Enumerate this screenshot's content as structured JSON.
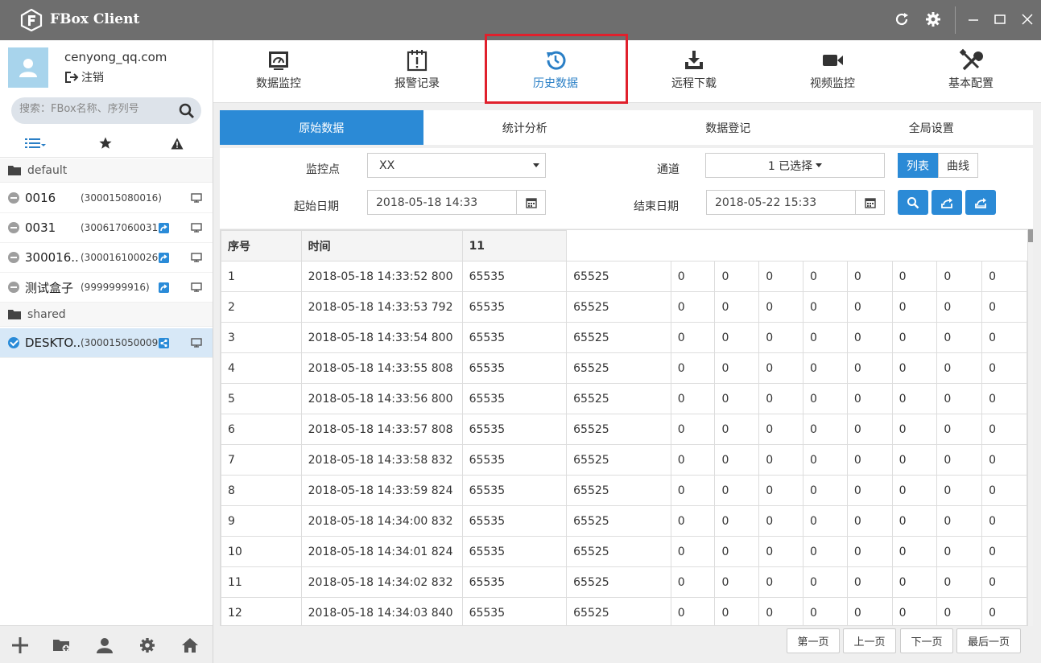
{
  "app": {
    "title": "FBox Client"
  },
  "sidebar": {
    "user_email": "cenyong_qq.com",
    "logout_label": "注销",
    "search_placeholder": "搜索：FBox名称、序列号",
    "groups": [
      {
        "label": "default"
      },
      {
        "label": "shared"
      }
    ],
    "devices": [
      {
        "name": "0016",
        "serial": "(300015080016)",
        "status": "offline",
        "badge": false
      },
      {
        "name": "0031",
        "serial": "(300617060031)",
        "status": "offline",
        "badge": true
      },
      {
        "name": "300016..",
        "serial": "(300016100026)",
        "status": "offline",
        "badge": true
      },
      {
        "name": "测试盒子",
        "serial": "(9999999916)",
        "status": "offline",
        "badge": true
      },
      {
        "name": "DESKTO..",
        "serial": "(300015050009)",
        "status": "online",
        "badge": true
      }
    ]
  },
  "nav": {
    "items": [
      {
        "label": "数据监控",
        "icon": "dashboard-icon"
      },
      {
        "label": "报警记录",
        "icon": "alarm-icon"
      },
      {
        "label": "历史数据",
        "icon": "history-icon"
      },
      {
        "label": "远程下载",
        "icon": "download-icon"
      },
      {
        "label": "视频监控",
        "icon": "video-icon"
      },
      {
        "label": "基本配置",
        "icon": "tools-icon"
      }
    ],
    "active": "历史数据"
  },
  "subtabs": [
    "原始数据",
    "统计分析",
    "数据登记",
    "全局设置"
  ],
  "filters": {
    "monitor_label": "监控点",
    "monitor_value": "XX",
    "channel_label": "通道",
    "channel_value": "1 已选择",
    "start_label": "起始日期",
    "start_value": "2018-05-18 14:33",
    "end_label": "结束日期",
    "end_value": "2018-05-22 15:33",
    "view_list": "列表",
    "view_curve": "曲线"
  },
  "table": {
    "headers": [
      "序号",
      "时间",
      "11"
    ],
    "rows": [
      [
        "1",
        "2018-05-18 14:33:52 800",
        "65535",
        "65525",
        "0",
        "0",
        "0",
        "0",
        "0",
        "0",
        "0",
        "0"
      ],
      [
        "2",
        "2018-05-18 14:33:53 792",
        "65535",
        "65525",
        "0",
        "0",
        "0",
        "0",
        "0",
        "0",
        "0",
        "0"
      ],
      [
        "3",
        "2018-05-18 14:33:54 800",
        "65535",
        "65525",
        "0",
        "0",
        "0",
        "0",
        "0",
        "0",
        "0",
        "0"
      ],
      [
        "4",
        "2018-05-18 14:33:55 808",
        "65535",
        "65525",
        "0",
        "0",
        "0",
        "0",
        "0",
        "0",
        "0",
        "0"
      ],
      [
        "5",
        "2018-05-18 14:33:56 800",
        "65535",
        "65525",
        "0",
        "0",
        "0",
        "0",
        "0",
        "0",
        "0",
        "0"
      ],
      [
        "6",
        "2018-05-18 14:33:57 808",
        "65535",
        "65525",
        "0",
        "0",
        "0",
        "0",
        "0",
        "0",
        "0",
        "0"
      ],
      [
        "7",
        "2018-05-18 14:33:58 832",
        "65535",
        "65525",
        "0",
        "0",
        "0",
        "0",
        "0",
        "0",
        "0",
        "0"
      ],
      [
        "8",
        "2018-05-18 14:33:59 824",
        "65535",
        "65525",
        "0",
        "0",
        "0",
        "0",
        "0",
        "0",
        "0",
        "0"
      ],
      [
        "9",
        "2018-05-18 14:34:00 832",
        "65535",
        "65525",
        "0",
        "0",
        "0",
        "0",
        "0",
        "0",
        "0",
        "0"
      ],
      [
        "10",
        "2018-05-18 14:34:01 824",
        "65535",
        "65525",
        "0",
        "0",
        "0",
        "0",
        "0",
        "0",
        "0",
        "0"
      ],
      [
        "11",
        "2018-05-18 14:34:02 832",
        "65535",
        "65525",
        "0",
        "0",
        "0",
        "0",
        "0",
        "0",
        "0",
        "0"
      ],
      [
        "12",
        "2018-05-18 14:34:03 840",
        "65535",
        "65525",
        "0",
        "0",
        "0",
        "0",
        "0",
        "0",
        "0",
        "0"
      ]
    ]
  },
  "pager": {
    "first": "第一页",
    "prev": "上一页",
    "next": "下一页",
    "last": "最后一页"
  },
  "colors": {
    "accent": "#2b8ad6",
    "titlebar": "#6e6e6e",
    "highlight": "#e0202c"
  }
}
